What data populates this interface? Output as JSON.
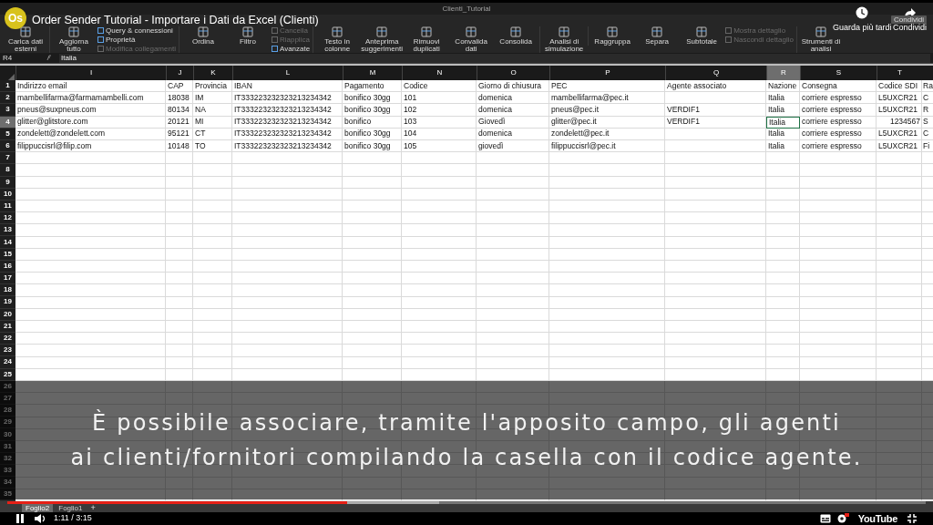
{
  "excel": {
    "document_title": "Clienti_Tutorial",
    "ribbon": [
      [
        {
          "label": "Carica dati esterni",
          "kind": "large",
          "disabled": false
        }
      ],
      [
        {
          "label": "Aggiorna tutto",
          "kind": "large",
          "disabled": false
        },
        {
          "label": "Query & connessioni",
          "kind": "small",
          "disabled": false
        },
        {
          "label": "Proprietà",
          "kind": "small",
          "disabled": false
        },
        {
          "label": "Modifica collegamenti",
          "kind": "small",
          "disabled": true
        }
      ],
      [
        {
          "label": "Ordina",
          "kind": "large",
          "disabled": false
        },
        {
          "label": "Filtro",
          "kind": "large",
          "disabled": false
        },
        {
          "label": "Cancella",
          "kind": "small",
          "disabled": true
        },
        {
          "label": "Riapplica",
          "kind": "small",
          "disabled": true
        },
        {
          "label": "Avanzate",
          "kind": "small",
          "disabled": false
        }
      ],
      [
        {
          "label": "Testo in colonne",
          "kind": "large",
          "disabled": false
        },
        {
          "label": "Anteprima suggerimenti",
          "kind": "large",
          "disabled": false
        },
        {
          "label": "Rimuovi duplicati",
          "kind": "large",
          "disabled": false
        },
        {
          "label": "Convalida dati",
          "kind": "large",
          "disabled": false
        },
        {
          "label": "Consolida",
          "kind": "large",
          "disabled": false
        }
      ],
      [
        {
          "label": "Analisi di simulazione",
          "kind": "large",
          "disabled": false
        }
      ],
      [
        {
          "label": "Raggruppa",
          "kind": "large",
          "disabled": false
        },
        {
          "label": "Separa",
          "kind": "large",
          "disabled": false
        },
        {
          "label": "Subtotale",
          "kind": "large",
          "disabled": false
        },
        {
          "label": "Mostra dettaglio",
          "kind": "small",
          "disabled": true
        },
        {
          "label": "Nascondi dettaglio",
          "kind": "small",
          "disabled": true
        }
      ],
      [
        {
          "label": "Strumenti di analisi",
          "kind": "large",
          "disabled": false
        }
      ]
    ],
    "name_box": "R4",
    "formula": "Italia",
    "columns": [
      {
        "letter": "I",
        "selected": false
      },
      {
        "letter": "J",
        "selected": false
      },
      {
        "letter": "K",
        "selected": false
      },
      {
        "letter": "L",
        "selected": false
      },
      {
        "letter": "M",
        "selected": false
      },
      {
        "letter": "N",
        "selected": false
      },
      {
        "letter": "O",
        "selected": false
      },
      {
        "letter": "P",
        "selected": false
      },
      {
        "letter": "Q",
        "selected": false
      },
      {
        "letter": "R",
        "selected": true
      },
      {
        "letter": "S",
        "selected": false
      },
      {
        "letter": "T",
        "selected": false
      }
    ],
    "rows": [
      {
        "number": "1",
        "selected": false,
        "cells": [
          "Indirizzo email",
          "CAP",
          "Provincia",
          "IBAN",
          "Pagamento",
          "Codice",
          "Giorno di chiusura",
          "PEC",
          "Agente associato",
          "Nazione",
          "Consegna",
          "Codice SDI",
          "Ra"
        ]
      },
      {
        "number": "2",
        "selected": false,
        "cells": [
          "mambellifarma@farmamambelli.com",
          "18038",
          "IM",
          "IT333223232323213234342",
          "bonifico 30gg",
          "101",
          "domenica",
          "mambellifarma@pec.it",
          "",
          "Italia",
          "corriere espresso",
          "L5UXCR21",
          "C"
        ]
      },
      {
        "number": "3",
        "selected": false,
        "cells": [
          "pneus@suxpneus.com",
          "80134",
          "NA",
          "IT333223232323213234342",
          "bonifico 30gg",
          "102",
          "domenica",
          "pneus@pec.it",
          "VERDIF1",
          "Italia",
          "corriere espresso",
          "L5UXCR21",
          "R"
        ]
      },
      {
        "number": "4",
        "selected": true,
        "cells": [
          "glitter@glitstore.com",
          "20121",
          "MI",
          "IT333223232323213234342",
          "bonifico",
          "103",
          "Giovedì",
          "glitter@pec.it",
          "VERDIF1",
          "Italia",
          "corriere espresso",
          {
            "text": "1234567",
            "numeric": true
          },
          "S"
        ]
      },
      {
        "number": "5",
        "selected": false,
        "cells": [
          "zondelett@zondelett.com",
          "95121",
          "CT",
          "IT333223232323213234342",
          "bonifico 30gg",
          "104",
          "domenica",
          "zondelett@pec.it",
          "",
          "Italia",
          "corriere espresso",
          "L5UXCR21",
          "C"
        ]
      },
      {
        "number": "6",
        "selected": false,
        "cells": [
          "filippuccisrl@filip.com",
          "10148",
          "TO",
          "IT333223232323213234342",
          "bonifico 30gg",
          "105",
          "giovedì",
          "filippuccisrl@pec.it",
          "",
          "Italia",
          "corriere espresso",
          "L5UXCR21",
          "Fi"
        ]
      },
      {
        "number": "7",
        "selected": false
      },
      {
        "number": "8",
        "selected": false
      },
      {
        "number": "9",
        "selected": false
      },
      {
        "number": "10",
        "selected": false
      },
      {
        "number": "11",
        "selected": false
      },
      {
        "number": "12",
        "selected": false
      },
      {
        "number": "13",
        "selected": false
      },
      {
        "number": "14",
        "selected": false
      },
      {
        "number": "15",
        "selected": false
      },
      {
        "number": "16",
        "selected": false
      },
      {
        "number": "17",
        "selected": false
      },
      {
        "number": "18",
        "selected": false
      },
      {
        "number": "19",
        "selected": false
      },
      {
        "number": "20",
        "selected": false
      },
      {
        "number": "21",
        "selected": false
      },
      {
        "number": "22",
        "selected": false
      },
      {
        "number": "23",
        "selected": false
      },
      {
        "number": "24",
        "selected": false
      },
      {
        "number": "25",
        "selected": false
      },
      {
        "number": "26",
        "selected": false
      },
      {
        "number": "27",
        "selected": false
      },
      {
        "number": "28",
        "selected": false
      },
      {
        "number": "29",
        "selected": false
      },
      {
        "number": "30",
        "selected": false
      },
      {
        "number": "31",
        "selected": false
      },
      {
        "number": "32",
        "selected": false
      },
      {
        "number": "33",
        "selected": false
      },
      {
        "number": "34",
        "selected": false
      },
      {
        "number": "35",
        "selected": false
      }
    ],
    "sheet_tabs": [
      {
        "label": "Foglio2",
        "selected": true
      },
      {
        "label": "Foglio1",
        "selected": false
      }
    ],
    "add_sheet": "+"
  },
  "video": {
    "logo": "Os",
    "title": "Order Sender Tutorial - Importare i Dati da Excel (Clienti)",
    "watch_later": "Guarda più tardi",
    "share": "Condividi",
    "share_tooltip": "Condividi",
    "subtitle": [
      "È possibile associare, tramite l'apposito campo, gli agenti",
      "ai clienti/fornitori compilando la casella con il codice agente."
    ],
    "progress": {
      "level": 0.37
    },
    "buffered": {
      "level": 0.47
    },
    "time": "1:11 / 3:15",
    "brand": "YouTube"
  }
}
